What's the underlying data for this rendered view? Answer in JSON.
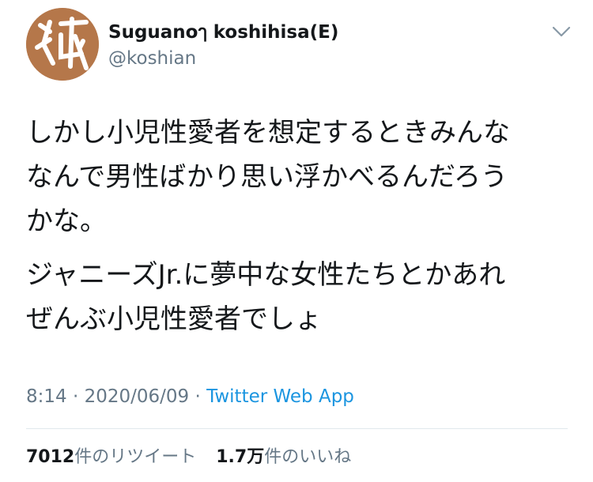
{
  "header": {
    "display_name": "Suguanoๅ koshihisa(E)",
    "handle": "@koshian",
    "avatar_glyph": "狐",
    "avatar_bg": "#b5774a",
    "caret_icon": "chevron-down-icon"
  },
  "tweet": {
    "paragraph_1": "しかし小児性愛者を想定するときみんな\nなんで男性ばかり思い浮かべるんだろう\nかな。",
    "paragraph_2": "ジャニーズJr.に夢中な女性たちとかあれ\nぜんぶ小児性愛者でしょ"
  },
  "meta": {
    "time": "8:14",
    "date": "2020/06/09",
    "separator": "·",
    "source": "Twitter Web App",
    "source_color": "#1b95e0"
  },
  "stats": {
    "retweets_count": "7012",
    "retweets_label": "件のリツイート",
    "likes_count": "1.7万",
    "likes_label": "件のいいね"
  }
}
